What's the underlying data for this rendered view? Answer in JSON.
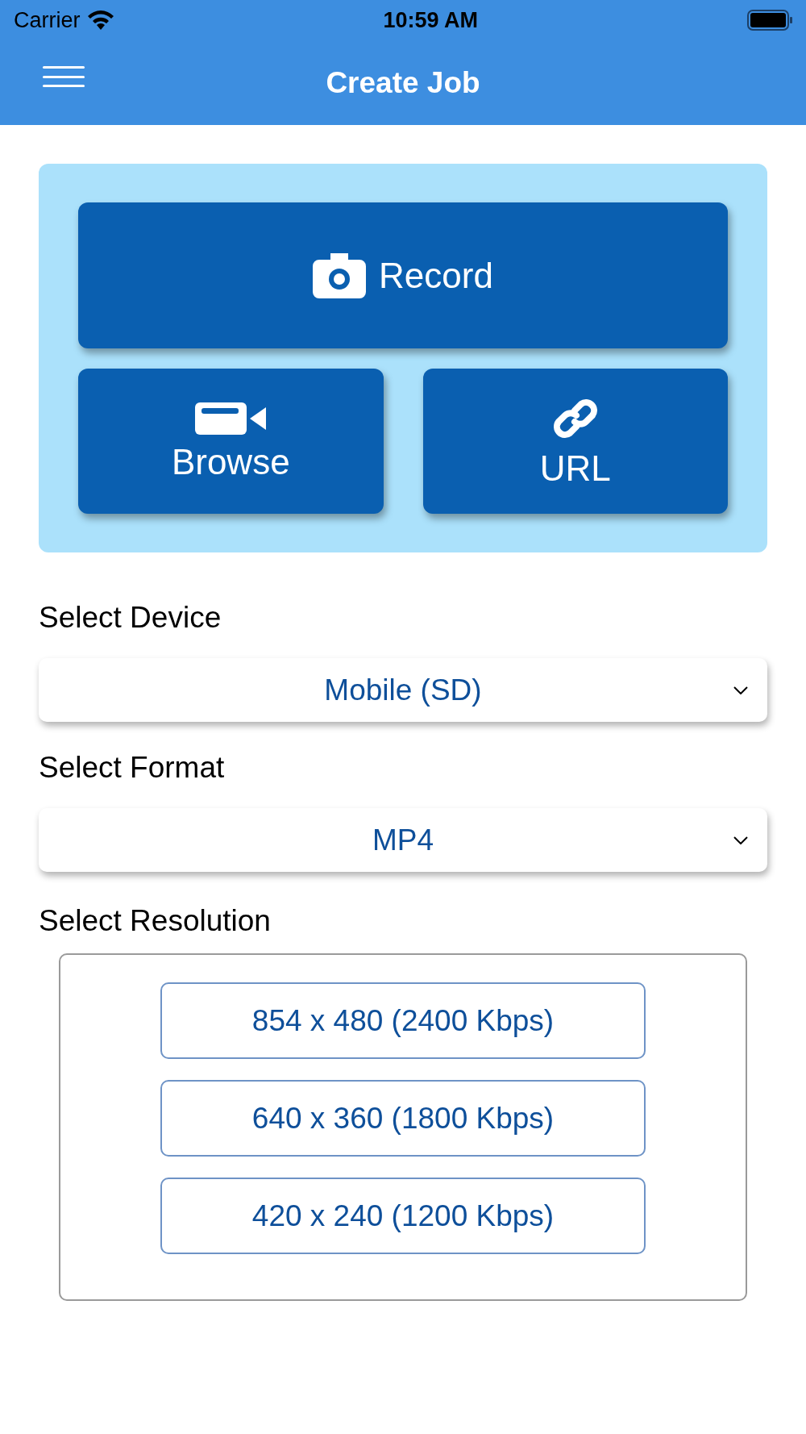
{
  "status_bar": {
    "carrier": "Carrier",
    "time": "10:59 AM"
  },
  "header": {
    "title": "Create Job"
  },
  "actions": [
    {
      "kind": "record",
      "label": "Record"
    },
    {
      "kind": "browse",
      "label": "Browse"
    },
    {
      "kind": "url",
      "label": "URL"
    }
  ],
  "device": {
    "label": "Select Device",
    "value": "Mobile (SD)"
  },
  "format": {
    "label": "Select Format",
    "value": "MP4"
  },
  "resolution": {
    "label": "Select Resolution",
    "options": [
      "854 x 480 (2400 Kbps)",
      "640 x 360 (1800 Kbps)",
      "420 x 240 (1200 Kbps)"
    ]
  }
}
